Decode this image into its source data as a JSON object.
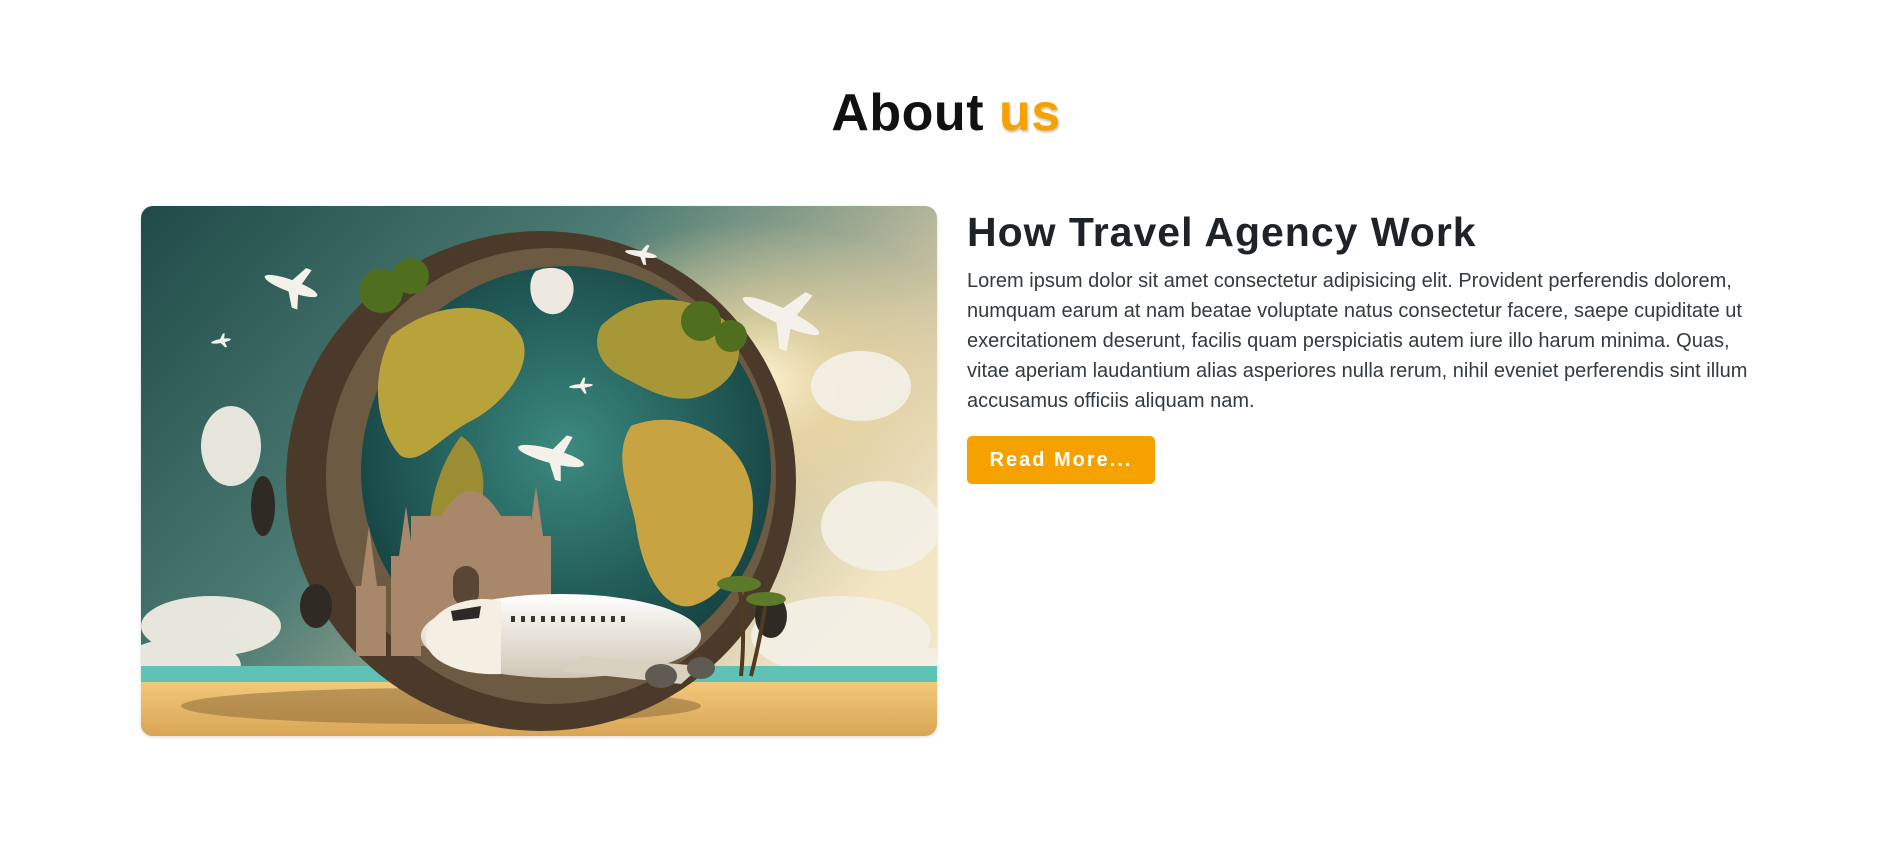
{
  "section": {
    "title_main": "About",
    "title_accent": "us"
  },
  "about": {
    "heading": "How Travel Agency Work",
    "paragraph": "Lorem ipsum dolor sit amet consectetur adipisicing elit. Provident perferendis dolorem, numquam earum at nam beatae voluptate natus consectetur facere, saepe cupiditate ut exercitationem deserunt, facilis quam perspiciatis autem iure illo harum minima. Quas, vitae aperiam laudantium alias asperiores nulla rerum, nihil eveniet perferendis sint illum accusamus officiis aliquam nam.",
    "button_label": "Read More..."
  },
  "colors": {
    "accent": "#f5a200",
    "heading": "#1f2328",
    "text": "#333a40"
  },
  "image": {
    "icon": "globe-travel-illustration"
  }
}
